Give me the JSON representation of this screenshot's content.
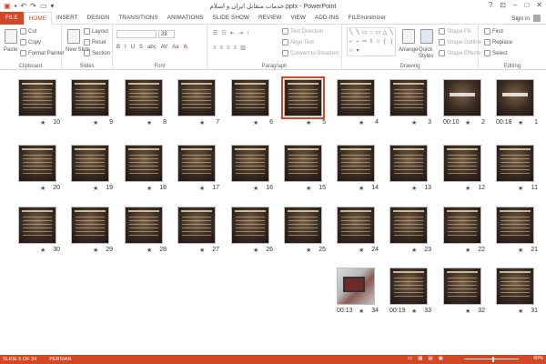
{
  "window": {
    "title": "خدمات متقابل ایران و اسلام.pptx - PowerPoint",
    "controls": [
      "?",
      "⊡",
      "–",
      "□",
      "✕"
    ]
  },
  "qat": [
    "▣",
    "💾",
    "↶",
    "↷",
    "⊡",
    "▾"
  ],
  "tabs": [
    "FILE",
    "HOME",
    "INSERT",
    "DESIGN",
    "TRANSITIONS",
    "ANIMATIONS",
    "SLIDE SHOW",
    "REVIEW",
    "VIEW",
    "ADD-INS",
    "FILEminimizer"
  ],
  "signin": "Sign in",
  "ribbon": {
    "clipboard": {
      "label": "Clipboard",
      "paste": "Paste",
      "cut": "Cut",
      "copy": "Copy",
      "format_painter": "Format Painter"
    },
    "slides": {
      "label": "Slides",
      "new_slide": "New Slide",
      "layout": "Layout",
      "reset": "Reset",
      "section": "Section"
    },
    "font": {
      "label": "Font",
      "size": "28",
      "buttons": [
        "B",
        "I",
        "U",
        "S",
        "abc",
        "AV",
        "Aa",
        "A"
      ]
    },
    "paragraph": {
      "label": "Paragraph",
      "text_direction": "Text Direction",
      "align_text": "Align Text",
      "convert": "Convert to SmartArt"
    },
    "drawing": {
      "label": "Drawing",
      "arrange": "Arrange",
      "quick_styles": "Quick Styles",
      "shape_fill": "Shape Fill",
      "shape_outline": "Shape Outline",
      "shape_effects": "Shape Effects"
    },
    "editing": {
      "label": "Editing",
      "find": "Find",
      "replace": "Replace",
      "select": "Select"
    }
  },
  "slides": [
    {
      "n": "1",
      "row": 0,
      "col": 0,
      "time": "00:18",
      "kind": "big"
    },
    {
      "n": "2",
      "row": 0,
      "col": 1,
      "time": "00:10",
      "kind": "big"
    },
    {
      "n": "3",
      "row": 0,
      "col": 2,
      "time": "",
      "kind": "text"
    },
    {
      "n": "4",
      "row": 0,
      "col": 3,
      "time": "",
      "kind": "text"
    },
    {
      "n": "5",
      "row": 0,
      "col": 4,
      "time": "",
      "kind": "text",
      "selected": true
    },
    {
      "n": "6",
      "row": 0,
      "col": 5,
      "time": "",
      "kind": "text"
    },
    {
      "n": "7",
      "row": 0,
      "col": 6,
      "time": "",
      "kind": "text"
    },
    {
      "n": "8",
      "row": 0,
      "col": 7,
      "time": "",
      "kind": "text"
    },
    {
      "n": "9",
      "row": 0,
      "col": 8,
      "time": "",
      "kind": "text"
    },
    {
      "n": "10",
      "row": 0,
      "col": 9,
      "time": "",
      "kind": "text"
    },
    {
      "n": "11",
      "row": 1,
      "col": 0,
      "time": "",
      "kind": "text"
    },
    {
      "n": "12",
      "row": 1,
      "col": 1,
      "time": "",
      "kind": "text"
    },
    {
      "n": "13",
      "row": 1,
      "col": 2,
      "time": "",
      "kind": "text"
    },
    {
      "n": "14",
      "row": 1,
      "col": 3,
      "time": "",
      "kind": "text"
    },
    {
      "n": "15",
      "row": 1,
      "col": 4,
      "time": "",
      "kind": "text"
    },
    {
      "n": "16",
      "row": 1,
      "col": 5,
      "time": "",
      "kind": "text"
    },
    {
      "n": "17",
      "row": 1,
      "col": 6,
      "time": "",
      "kind": "text"
    },
    {
      "n": "18",
      "row": 1,
      "col": 7,
      "time": "",
      "kind": "text"
    },
    {
      "n": "19",
      "row": 1,
      "col": 8,
      "time": "",
      "kind": "text"
    },
    {
      "n": "20",
      "row": 1,
      "col": 9,
      "time": "",
      "kind": "text"
    },
    {
      "n": "21",
      "row": 2,
      "col": 0,
      "time": "",
      "kind": "text"
    },
    {
      "n": "22",
      "row": 2,
      "col": 1,
      "time": "",
      "kind": "text"
    },
    {
      "n": "23",
      "row": 2,
      "col": 2,
      "time": "",
      "kind": "text"
    },
    {
      "n": "24",
      "row": 2,
      "col": 3,
      "time": "",
      "kind": "text"
    },
    {
      "n": "25",
      "row": 2,
      "col": 4,
      "time": "",
      "kind": "text"
    },
    {
      "n": "26",
      "row": 2,
      "col": 5,
      "time": "",
      "kind": "text"
    },
    {
      "n": "27",
      "row": 2,
      "col": 6,
      "time": "",
      "kind": "text"
    },
    {
      "n": "28",
      "row": 2,
      "col": 7,
      "time": "",
      "kind": "text"
    },
    {
      "n": "29",
      "row": 2,
      "col": 8,
      "time": "",
      "kind": "text"
    },
    {
      "n": "30",
      "row": 2,
      "col": 9,
      "time": "",
      "kind": "text"
    },
    {
      "n": "31",
      "row": 3,
      "col": 0,
      "time": "",
      "kind": "text"
    },
    {
      "n": "32",
      "row": 3,
      "col": 1,
      "time": "",
      "kind": "text"
    },
    {
      "n": "33",
      "row": 3,
      "col": 2,
      "time": "00:19",
      "kind": "text"
    },
    {
      "n": "34",
      "row": 3,
      "col": 3,
      "time": "00:13",
      "kind": "photo"
    }
  ],
  "status": {
    "slide": "SLIDE 5 OF 34",
    "lang": "PERSIAN",
    "zoom": "40%"
  }
}
